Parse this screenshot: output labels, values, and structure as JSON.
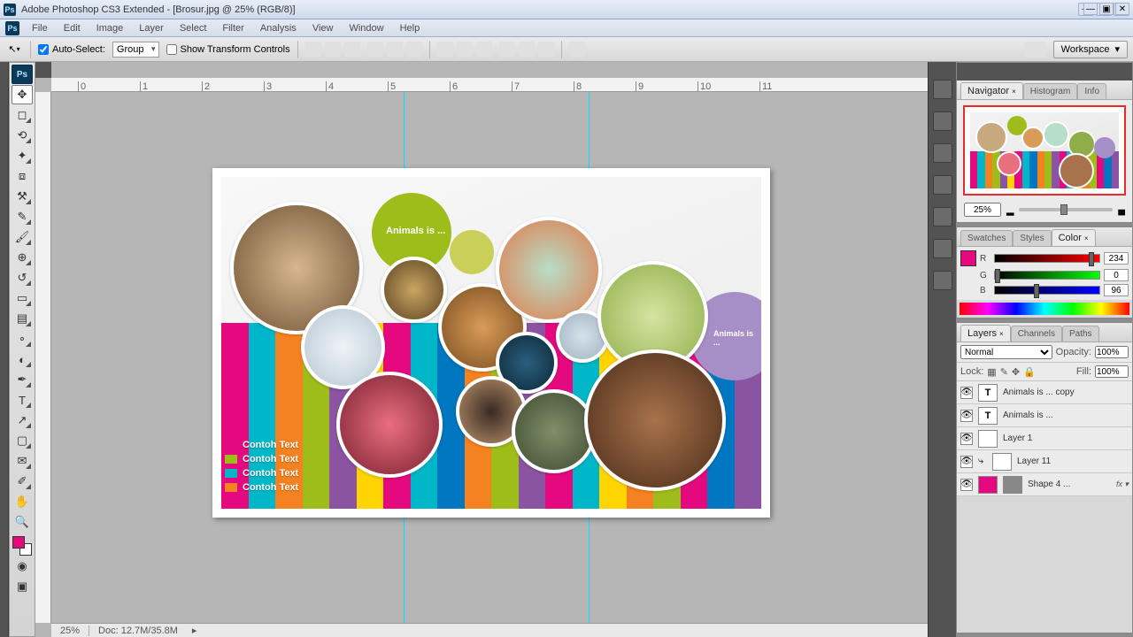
{
  "app": {
    "title": "Adobe Photoshop CS3 Extended - [Brosur.jpg @ 25% (RGB/8)]",
    "ps_badge": "Ps"
  },
  "menu": [
    "File",
    "Edit",
    "Image",
    "Layer",
    "Select",
    "Filter",
    "Analysis",
    "View",
    "Window",
    "Help"
  ],
  "options": {
    "auto_select_label": "Auto-Select:",
    "auto_select_value": "Group",
    "show_transform_label": "Show Transform Controls",
    "workspace_label": "Workspace"
  },
  "ruler_marks": [
    "0",
    "1",
    "2",
    "3",
    "4",
    "5",
    "6",
    "7",
    "8",
    "9",
    "10",
    "11"
  ],
  "canvas": {
    "bubble_main": "Animals is ...",
    "bubble_side": "Animals is ...",
    "legend_items": [
      {
        "color": "#e5097f",
        "text": "Contoh Text"
      },
      {
        "color": "#9fbd1a",
        "text": "Contoh Text"
      },
      {
        "color": "#00b6c9",
        "text": "Contoh Text"
      },
      {
        "color": "#f58220",
        "text": "Contoh Text"
      }
    ],
    "stripe_colors": [
      "#e5097f",
      "#00b6c9",
      "#f58220",
      "#9fbd1a",
      "#8a54a2",
      "#ffd400",
      "#e5097f",
      "#00b6c9",
      "#0077c0",
      "#f58220",
      "#9fbd1a",
      "#8a54a2",
      "#e5097f",
      "#00b6c9",
      "#ffd400",
      "#f58220",
      "#9fbd1a",
      "#e5097f",
      "#0077c0",
      "#8a54a2"
    ]
  },
  "status": {
    "zoom": "25%",
    "doc_info": "Doc: 12.7M/35.8M"
  },
  "navigator": {
    "tabs": [
      "Navigator",
      "Histogram",
      "Info"
    ],
    "zoom_value": "25%"
  },
  "color": {
    "tabs": [
      "Swatches",
      "Styles",
      "Color"
    ],
    "channels": [
      {
        "label": "R",
        "value": "234",
        "grad": "linear-gradient(90deg,#000,#f00)",
        "knob": "90%"
      },
      {
        "label": "G",
        "value": "0",
        "grad": "linear-gradient(90deg,#000,#0f0)",
        "knob": "0%"
      },
      {
        "label": "B",
        "value": "96",
        "grad": "linear-gradient(90deg,#000,#00f)",
        "knob": "37%"
      }
    ]
  },
  "layers": {
    "tabs": [
      "Layers",
      "Channels",
      "Paths"
    ],
    "blend_mode": "Normal",
    "opacity_label": "Opacity:",
    "opacity_value": "100%",
    "lock_label": "Lock:",
    "fill_label": "Fill:",
    "fill_value": "100%",
    "rows": [
      {
        "vis": true,
        "thumb": "T",
        "name": "Animals is ... copy"
      },
      {
        "vis": true,
        "thumb": "T",
        "name": "Animals is ..."
      },
      {
        "vis": true,
        "thumb": "checker",
        "name": "Layer 1"
      },
      {
        "vis": true,
        "thumb": "checker",
        "indent": true,
        "name": "Layer 11"
      },
      {
        "vis": true,
        "thumb": "shape",
        "name": "Shape 4 ...",
        "fx": "fx"
      }
    ]
  },
  "tools": [
    {
      "name": "ps-home",
      "glyph": "Ps",
      "cls": "ps-badge"
    },
    {
      "name": "move-tool",
      "glyph": "✥",
      "active": true
    },
    {
      "name": "marquee-tool",
      "glyph": "◻",
      "corner": true
    },
    {
      "name": "lasso-tool",
      "glyph": "⟲",
      "corner": true
    },
    {
      "name": "wand-tool",
      "glyph": "✦",
      "corner": true
    },
    {
      "name": "crop-tool",
      "glyph": "⧈"
    },
    {
      "name": "slice-tool",
      "glyph": "⚒",
      "corner": true
    },
    {
      "name": "heal-tool",
      "glyph": "✎",
      "corner": true
    },
    {
      "name": "brush-tool",
      "glyph": "🖌",
      "corner": true
    },
    {
      "name": "stamp-tool",
      "glyph": "⊕",
      "corner": true
    },
    {
      "name": "history-tool",
      "glyph": "↺",
      "corner": true
    },
    {
      "name": "eraser-tool",
      "glyph": "▭",
      "corner": true
    },
    {
      "name": "gradient-tool",
      "glyph": "▤",
      "corner": true
    },
    {
      "name": "blur-tool",
      "glyph": "∘",
      "corner": true
    },
    {
      "name": "dodge-tool",
      "glyph": "◐",
      "corner": true
    },
    {
      "name": "pen-tool",
      "glyph": "✒",
      "corner": true
    },
    {
      "name": "type-tool",
      "glyph": "T",
      "corner": true
    },
    {
      "name": "path-tool",
      "glyph": "↗",
      "corner": true
    },
    {
      "name": "shape-tool",
      "glyph": "▢",
      "corner": true
    },
    {
      "name": "notes-tool",
      "glyph": "✉",
      "corner": true
    },
    {
      "name": "eyedropper-tool",
      "glyph": "✐",
      "corner": true
    },
    {
      "name": "hand-tool",
      "glyph": "✋"
    },
    {
      "name": "zoom-tool",
      "glyph": "🔍"
    }
  ]
}
